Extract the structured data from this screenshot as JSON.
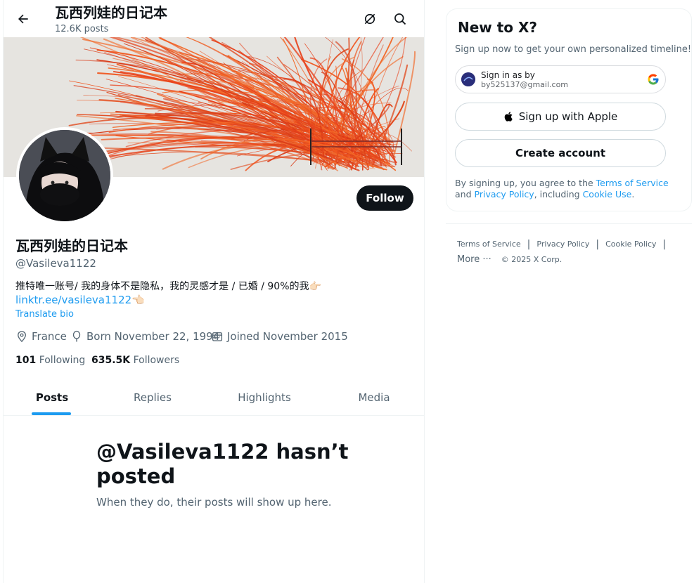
{
  "header": {
    "title": "瓦西列娃的日记本",
    "posts_count": "12.6K posts"
  },
  "profile": {
    "name": "瓦西列娃的日记本",
    "handle": "@Vasileva1122",
    "bio": "推特唯一账号/ 我的身体不是隐私，我的灵感才是 / 已婚 / 90%的我👉🏻",
    "bio_link": "linktr.ee/vasileva1122👈🏻",
    "translate_label": "Translate bio",
    "follow_label": "Follow",
    "location": "France",
    "birthday": "Born November 22, 1994",
    "joined": "Joined November 2015",
    "following_count": "101",
    "following_label": "Following",
    "followers_count": "635.5K",
    "followers_label": "Followers"
  },
  "tabs": [
    {
      "label": "Posts",
      "active": true
    },
    {
      "label": "Replies",
      "active": false
    },
    {
      "label": "Highlights",
      "active": false
    },
    {
      "label": "Media",
      "active": false
    }
  ],
  "empty_state": {
    "title": "@Vasileva1122 hasn’t posted",
    "subtitle": "When they do, their posts will show up here."
  },
  "signup": {
    "title": "New to X?",
    "subtitle": "Sign up now to get your own personalized timeline!",
    "google_line1": "Sign in as by",
    "google_line2": "by525137@gmail.com",
    "apple_label": "Sign up with Apple",
    "create_label": "Create account",
    "terms_prefix": "By signing up, you agree to the",
    "terms_link": "Terms of Service",
    "terms_and": "and",
    "privacy_link": "Privacy Policy",
    "terms_including": ", including",
    "cookie_link": "Cookie Use",
    "terms_end": "."
  },
  "footer": {
    "terms": "Terms of Service",
    "privacy": "Privacy Policy",
    "cookie": "Cookie Policy",
    "more": "More ···",
    "copyright": "© 2025 X Corp."
  },
  "colors": {
    "accent": "#1d9bf0",
    "text_primary": "#0f1419",
    "text_secondary": "#536471",
    "follow_bg": "#0f1419",
    "banner_feathers": "#e8421c"
  },
  "icons": [
    "back-arrow-icon",
    "grok-icon",
    "search-icon",
    "location-icon",
    "birthday-balloon-icon",
    "calendar-icon",
    "apple-icon",
    "google-icon"
  ]
}
